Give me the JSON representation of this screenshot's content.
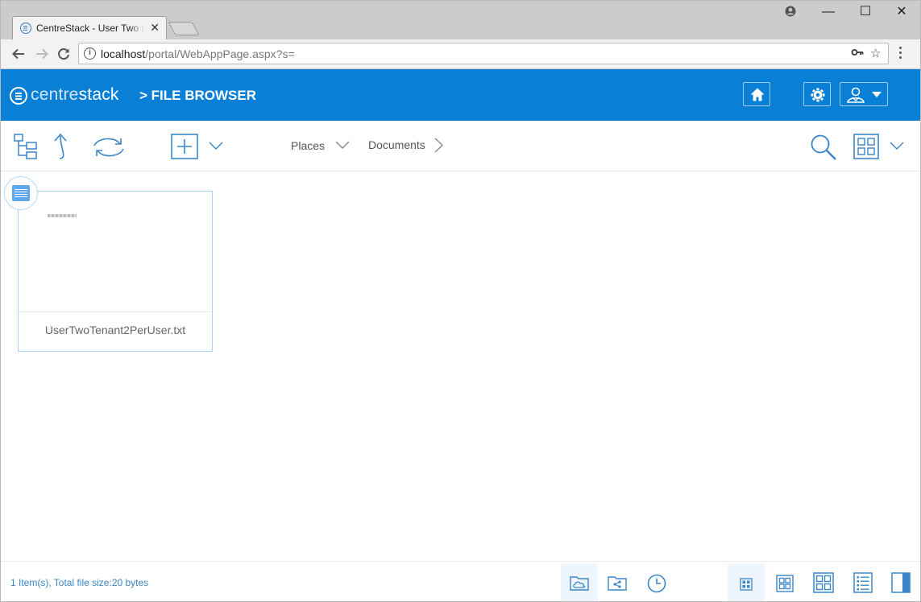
{
  "browser": {
    "tab_title": "CentreStack - User Two (u",
    "tab_close": "✕",
    "url_host": "localhost",
    "url_path": "/portal/WebAppPage.aspx?s=",
    "window_controls": [
      "—",
      "☐",
      "✕"
    ]
  },
  "header": {
    "logo_main": "centre",
    "logo_accent": "stack",
    "breadcrumb": ">  FILE BROWSER",
    "buttons": [
      "home-icon",
      "gear-icon",
      "user-icon"
    ]
  },
  "toolbar": {
    "places_label": "Places",
    "documents_label": "Documents",
    "tools": [
      "folder-tree-icon",
      "up-arrow-icon",
      "refresh-icon",
      "add-icon",
      "search-icon",
      "grid-view-icon"
    ]
  },
  "files": [
    {
      "name": "UserTwoTenant2PerUser.txt",
      "icon": "text-file-icon"
    }
  ],
  "footer": {
    "status": "1 Item(s), Total file size:20 bytes",
    "left_buttons": [
      "cloud-folder-icon",
      "shared-folder-icon",
      "clock-icon"
    ],
    "view_buttons": [
      "small-grid-icon",
      "medium-grid-icon",
      "large-grid-icon",
      "list-view-icon",
      "preview-pane-icon"
    ]
  },
  "colors": {
    "brand_blue": "#0a7fd6",
    "icon_blue": "#3a86c8",
    "tab_strip": "#cccccc"
  }
}
